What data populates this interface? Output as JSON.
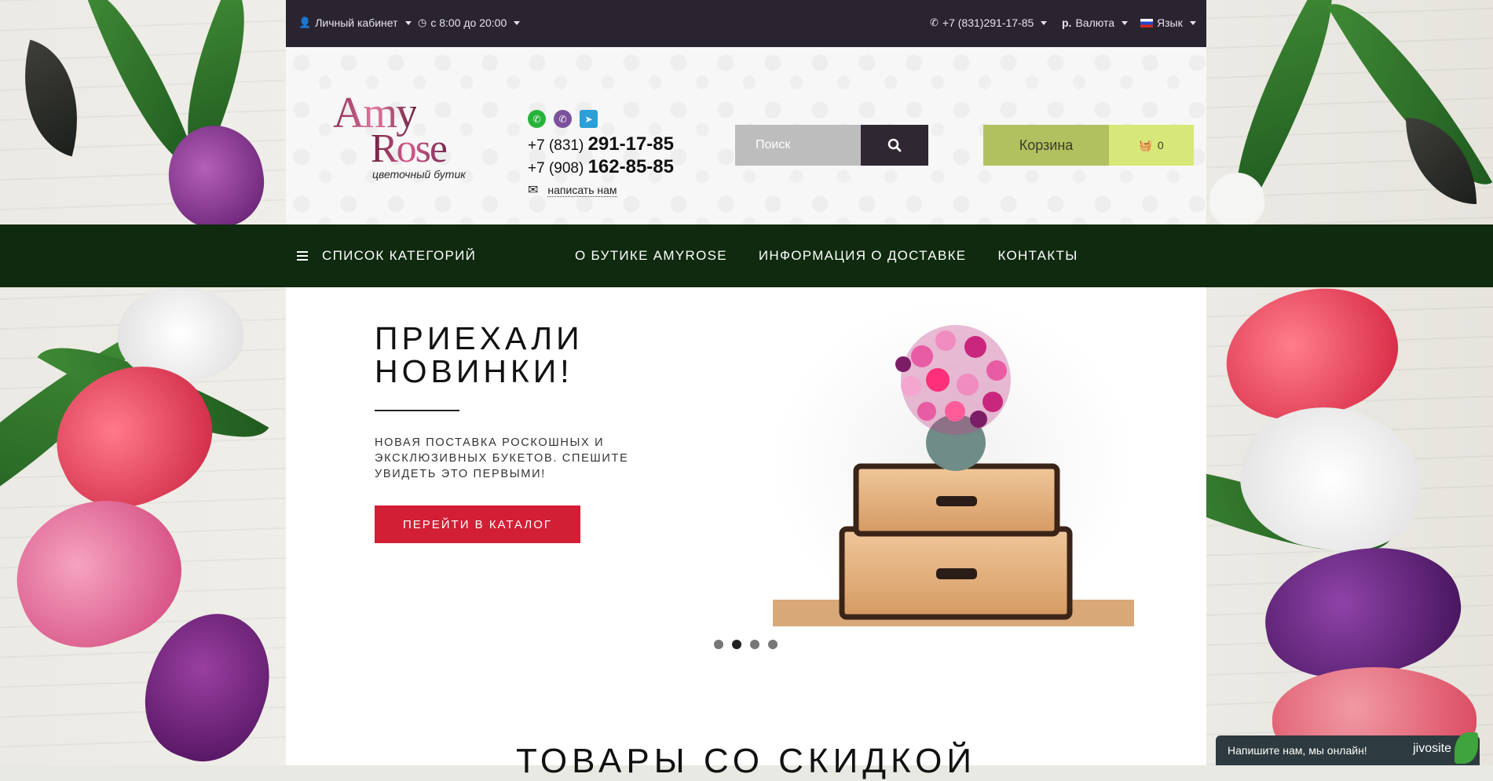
{
  "topbar": {
    "account_label": "Личный кабинет",
    "hours_label": "с 8:00 до 20:00",
    "phone_label": "+7 (831)291-17-85",
    "currency_symbol": "р.",
    "currency_label": "Валюта",
    "language_label": "Язык"
  },
  "header": {
    "logo_line1": "Amy",
    "logo_line2": "Rose",
    "logo_tagline": "цветочный бутик",
    "phones": [
      {
        "prefix": "+7 (831)",
        "number": "291-17-85"
      },
      {
        "prefix": "+7 (908)",
        "number": "162-85-85"
      }
    ],
    "write_us": "написать нам",
    "search_placeholder": "Поиск",
    "cart_label": "Корзина",
    "cart_count": "0"
  },
  "nav": {
    "categories_label": "СПИСОК КАТЕГОРИЙ",
    "links": [
      "О БУТИКЕ AMYROSE",
      "ИНФОРМАЦИЯ О ДОСТАВКЕ",
      "КОНТАКТЫ"
    ]
  },
  "hero": {
    "title_line1": "ПРИЕХАЛИ",
    "title_line2": "НОВИНКИ!",
    "description": "НОВАЯ ПОСТАВКА РОСКОШНЫХ И ЭКСКЛЮЗИВНЫХ БУКЕТОВ. СПЕШИТЕ УВИДЕТЬ ЭТО ПЕРВЫМИ!",
    "button_label": "ПЕРЕЙТИ В КАТАЛОГ",
    "active_slide": 2,
    "slide_count": 4
  },
  "section_title": "ТОВАРЫ СО СКИДКОЙ",
  "chat": {
    "label": "Напишите нам, мы онлайн!",
    "brand": "jivosite"
  },
  "colors": {
    "topbar": "#2a2430",
    "nav": "#0f2a0e",
    "cta": "#d21f35",
    "cart_label": "#b2c15f",
    "cart_count": "#d7e878",
    "search_button": "#2f2833"
  }
}
